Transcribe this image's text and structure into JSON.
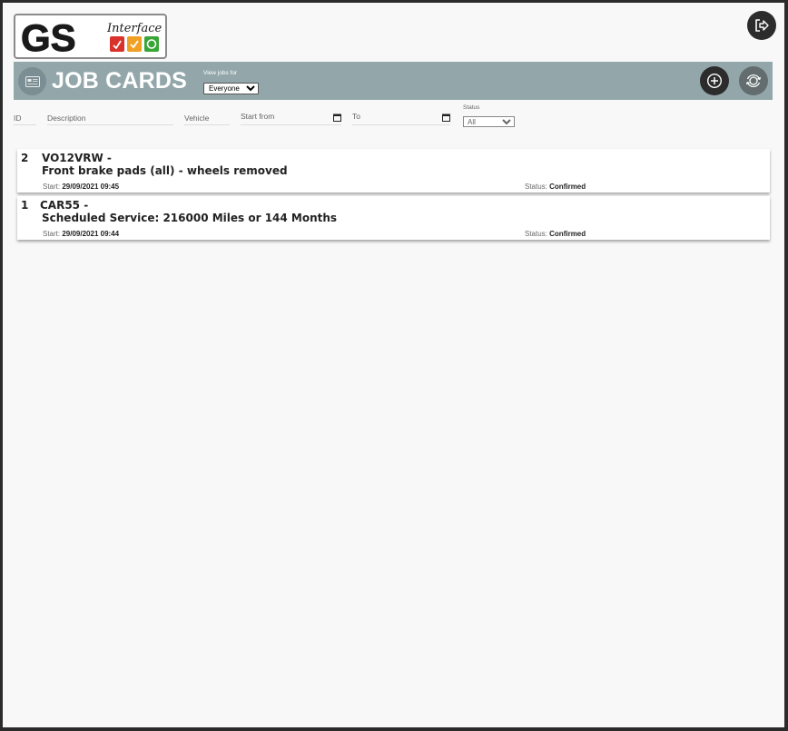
{
  "logo": {
    "brand": "GS",
    "tagline": "Interface"
  },
  "header": {
    "title": "JOB CARDS",
    "view_label": "View jobs for",
    "view_selected": "Everyone",
    "icons": {
      "section": "job-card-icon",
      "add": "plus-circle-icon",
      "sync": "sync-icon",
      "logout": "logout-icon"
    }
  },
  "filters": {
    "id_placeholder": "ID",
    "description_placeholder": "Description",
    "vehicle_placeholder": "Vehicle",
    "start_from_label": "Start from",
    "to_label": "To",
    "status_label": "Status",
    "status_selected": "All"
  },
  "jobs": [
    {
      "id": "2",
      "reg": "VO12VRW -",
      "description": "Front brake pads (all) - wheels removed",
      "start_label": "Start:",
      "start": "29/09/2021 09:45",
      "status_label": "Status:",
      "status": "Confirmed"
    },
    {
      "id": "1",
      "reg": "CAR55 -",
      "description": "Scheduled Service: 216000 Miles or 144 Months",
      "start_label": "Start:",
      "start": "29/09/2021 09:44",
      "status_label": "Status:",
      "status": "Confirmed"
    }
  ],
  "colors": {
    "header_bar": "#93a7ab",
    "dark_button": "#2c2c2c",
    "logo_red": "#d9322b",
    "logo_orange": "#f0a024",
    "logo_green": "#3aa537"
  }
}
